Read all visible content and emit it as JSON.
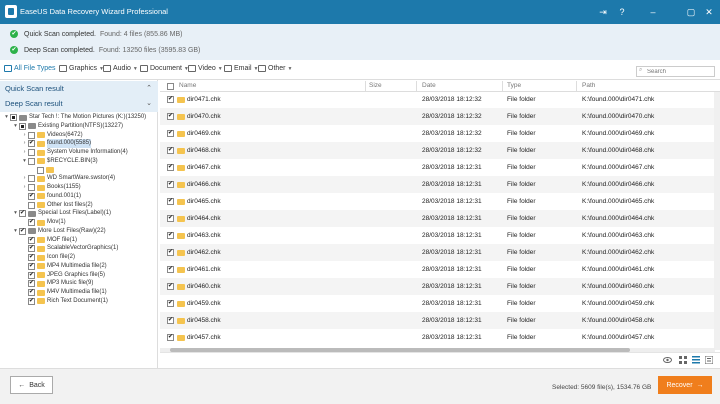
{
  "window": {
    "title": "EaseUS Data Recovery Wizard Professional"
  },
  "scans": [
    {
      "label": "Quick Scan completed.",
      "info": "Found: 4 files (855.86 MB)"
    },
    {
      "label": "Deep Scan completed.",
      "info": "Found: 13250 files (3595.83 GB)"
    }
  ],
  "filters": [
    "All File Types",
    "Graphics",
    "Audio",
    "Document",
    "Video",
    "Email",
    "Other"
  ],
  "search": {
    "placeholder": "Search"
  },
  "sidebar": {
    "quick_head": "Quick Scan result",
    "deep_head": "Deep Scan result",
    "tree": [
      {
        "label": "Star Tech !: The Motion Pictures (K:)(13250)",
        "level": 0,
        "toggle": "▾",
        "check": "partial",
        "icon": "drive"
      },
      {
        "label": "Existing Partition(NTFS)(13227)",
        "level": 1,
        "toggle": "▾",
        "check": "partial",
        "icon": "drive"
      },
      {
        "label": "Videos(6472)",
        "level": 2,
        "toggle": "›",
        "check": "",
        "icon": "folder"
      },
      {
        "label": "found.000(5585)",
        "level": 2,
        "toggle": "›",
        "check": "on",
        "icon": "folder",
        "selected": true
      },
      {
        "label": "System Volume Information(4)",
        "level": 2,
        "toggle": "›",
        "check": "",
        "icon": "folder"
      },
      {
        "label": "$RECYCLE.BIN(3)",
        "level": 2,
        "toggle": "▾",
        "check": "",
        "icon": "folder"
      },
      {
        "label": "",
        "level": 3,
        "toggle": "",
        "check": "",
        "icon": "folder"
      },
      {
        "label": "WD SmartWare.swstor(4)",
        "level": 2,
        "toggle": "›",
        "check": "",
        "icon": "folder"
      },
      {
        "label": "Books(1155)",
        "level": 2,
        "toggle": "›",
        "check": "",
        "icon": "folder"
      },
      {
        "label": "found.001(1)",
        "level": 2,
        "toggle": "",
        "check": "on",
        "icon": "folder"
      },
      {
        "label": "Other lost files(2)",
        "level": 2,
        "toggle": "",
        "check": "",
        "icon": "folder"
      },
      {
        "label": "Special Lost Files(Label)(1)",
        "level": 1,
        "toggle": "▾",
        "check": "on",
        "icon": "drive"
      },
      {
        "label": "Mov(1)",
        "level": 2,
        "toggle": "",
        "check": "on",
        "icon": "folder"
      },
      {
        "label": "More Lost Files(Raw)(22)",
        "level": 1,
        "toggle": "▾",
        "check": "on",
        "icon": "drive"
      },
      {
        "label": "MOF file(1)",
        "level": 2,
        "toggle": "",
        "check": "on",
        "icon": "folder"
      },
      {
        "label": "ScalableVectorGraphics(1)",
        "level": 2,
        "toggle": "",
        "check": "on",
        "icon": "folder"
      },
      {
        "label": "Icon file(2)",
        "level": 2,
        "toggle": "",
        "check": "on",
        "icon": "folder"
      },
      {
        "label": "MP4 Multimedia file(2)",
        "level": 2,
        "toggle": "",
        "check": "on",
        "icon": "folder"
      },
      {
        "label": "JPEG Graphics file(5)",
        "level": 2,
        "toggle": "",
        "check": "on",
        "icon": "folder"
      },
      {
        "label": "MP3 Music file(9)",
        "level": 2,
        "toggle": "",
        "check": "on",
        "icon": "folder"
      },
      {
        "label": "M4V Multimedia file(1)",
        "level": 2,
        "toggle": "",
        "check": "on",
        "icon": "folder"
      },
      {
        "label": "Rich Text Document(1)",
        "level": 2,
        "toggle": "",
        "check": "on",
        "icon": "folder"
      }
    ]
  },
  "table": {
    "columns": [
      "Name",
      "Size",
      "Date",
      "Type",
      "Path"
    ],
    "rows": [
      {
        "name": "dir0471.chk",
        "size": "",
        "date": "28/03/2018 18:12:32",
        "type": "File folder",
        "path": "K:\\found.000\\dir0471.chk"
      },
      {
        "name": "dir0470.chk",
        "size": "",
        "date": "28/03/2018 18:12:32",
        "type": "File folder",
        "path": "K:\\found.000\\dir0470.chk"
      },
      {
        "name": "dir0469.chk",
        "size": "",
        "date": "28/03/2018 18:12:32",
        "type": "File folder",
        "path": "K:\\found.000\\dir0469.chk"
      },
      {
        "name": "dir0468.chk",
        "size": "",
        "date": "28/03/2018 18:12:32",
        "type": "File folder",
        "path": "K:\\found.000\\dir0468.chk"
      },
      {
        "name": "dir0467.chk",
        "size": "",
        "date": "28/03/2018 18:12:31",
        "type": "File folder",
        "path": "K:\\found.000\\dir0467.chk"
      },
      {
        "name": "dir0466.chk",
        "size": "",
        "date": "28/03/2018 18:12:31",
        "type": "File folder",
        "path": "K:\\found.000\\dir0466.chk"
      },
      {
        "name": "dir0465.chk",
        "size": "",
        "date": "28/03/2018 18:12:31",
        "type": "File folder",
        "path": "K:\\found.000\\dir0465.chk"
      },
      {
        "name": "dir0464.chk",
        "size": "",
        "date": "28/03/2018 18:12:31",
        "type": "File folder",
        "path": "K:\\found.000\\dir0464.chk"
      },
      {
        "name": "dir0463.chk",
        "size": "",
        "date": "28/03/2018 18:12:31",
        "type": "File folder",
        "path": "K:\\found.000\\dir0463.chk"
      },
      {
        "name": "dir0462.chk",
        "size": "",
        "date": "28/03/2018 18:12:31",
        "type": "File folder",
        "path": "K:\\found.000\\dir0462.chk"
      },
      {
        "name": "dir0461.chk",
        "size": "",
        "date": "28/03/2018 18:12:31",
        "type": "File folder",
        "path": "K:\\found.000\\dir0461.chk"
      },
      {
        "name": "dir0460.chk",
        "size": "",
        "date": "28/03/2018 18:12:31",
        "type": "File folder",
        "path": "K:\\found.000\\dir0460.chk"
      },
      {
        "name": "dir0459.chk",
        "size": "",
        "date": "28/03/2018 18:12:31",
        "type": "File folder",
        "path": "K:\\found.000\\dir0459.chk"
      },
      {
        "name": "dir0458.chk",
        "size": "",
        "date": "28/03/2018 18:12:31",
        "type": "File folder",
        "path": "K:\\found.000\\dir0458.chk"
      },
      {
        "name": "dir0457.chk",
        "size": "",
        "date": "28/03/2018 18:12:31",
        "type": "File folder",
        "path": "K:\\found.000\\dir0457.chk"
      }
    ]
  },
  "footer": {
    "back_label": "Back",
    "selected_text": "Selected: 5609 file(s), 1534.76 GB",
    "recover_label": "Recover"
  },
  "colors": {
    "titlebar": "#1d79ab",
    "accent": "#1d79ab",
    "recover": "#f07e1c",
    "success": "#2db24a"
  }
}
